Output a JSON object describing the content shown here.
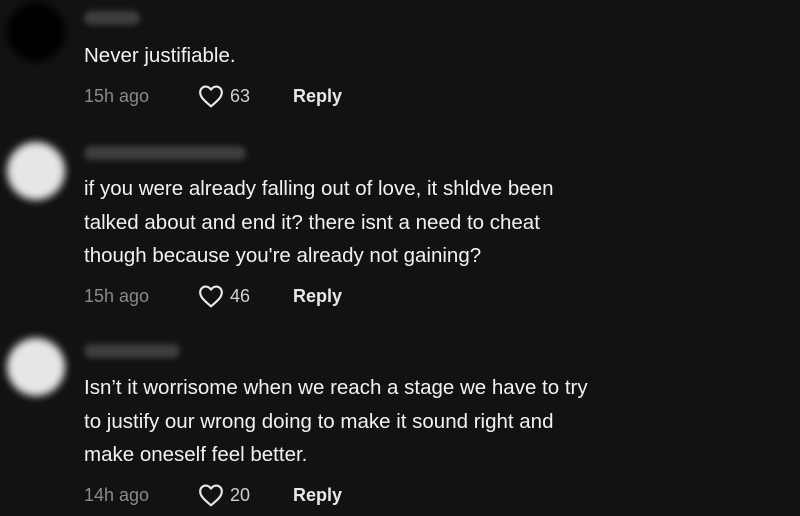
{
  "comments": [
    {
      "avatar_style": "dark",
      "text_lines": [
        "Never justifiable."
      ],
      "time": "15h ago",
      "likes": "63",
      "reply_label": "Reply"
    },
    {
      "avatar_style": "light",
      "text_lines": [
        "if you were already falling out of love, it shldve been",
        "talked about and end it? there isnt a need to cheat",
        "though because you're already not gaining?"
      ],
      "time": "15h ago",
      "likes": "46",
      "reply_label": "Reply"
    },
    {
      "avatar_style": "light",
      "text_lines": [
        "Isn’t it worrisome when we reach a stage we have to try",
        "to justify our wrong doing to make it sound right and",
        "make oneself feel better."
      ],
      "time": "14h ago",
      "likes": "20",
      "reply_label": "Reply"
    }
  ],
  "colors": {
    "background": "#121212",
    "text": "#f2f2f2",
    "muted": "#8a8a8a"
  },
  "icons": {
    "like": "heart-outline-icon"
  }
}
